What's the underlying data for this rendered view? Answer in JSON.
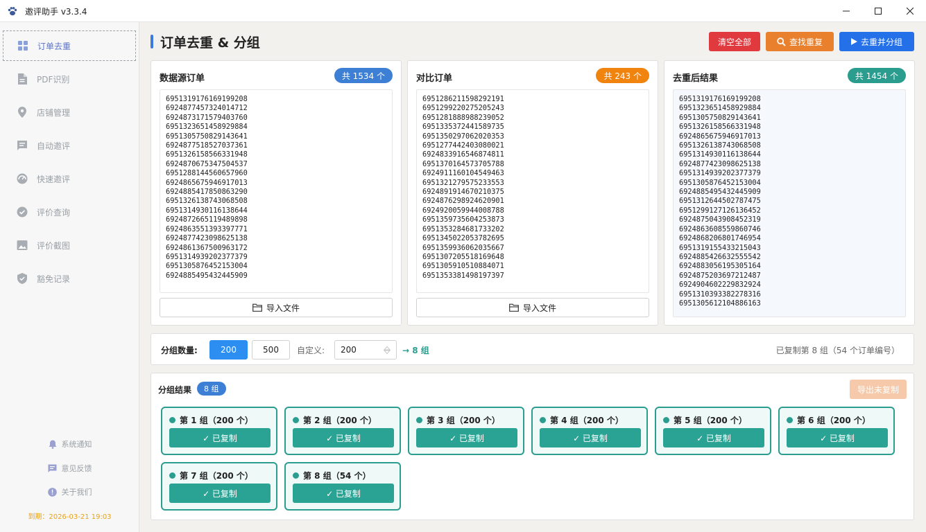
{
  "window": {
    "title": "邀评助手 v3.3.4"
  },
  "sidebar": {
    "items": [
      {
        "label": "订单去重",
        "icon": "grid-icon",
        "active": true
      },
      {
        "label": "PDF识别",
        "icon": "file-icon",
        "active": false
      },
      {
        "label": "店铺管理",
        "icon": "location-pin-icon",
        "active": false
      },
      {
        "label": "自动邀评",
        "icon": "chat-icon",
        "active": false
      },
      {
        "label": "快速邀评",
        "icon": "speed-icon",
        "active": false
      },
      {
        "label": "评价查询",
        "icon": "check-circle-icon",
        "active": false
      },
      {
        "label": "评价截图",
        "icon": "image-icon",
        "active": false
      },
      {
        "label": "豁免记录",
        "icon": "shield-check-icon",
        "active": false
      }
    ],
    "footer": {
      "notice": "系统通知",
      "feedback": "意见反馈",
      "about": "关于我们",
      "expire": "到期：2026-03-21 19:03"
    }
  },
  "header": {
    "title": "订单去重 & 分组",
    "clear_label": "清空全部",
    "find_label": "查找重复",
    "dedupe_label": "去重并分组"
  },
  "panels": {
    "source": {
      "title": "数据源订单",
      "count": "共 1534 个",
      "import_label": "导入文件",
      "lines": [
        "6951319176169199208",
        "6924877457324014712",
        "6924873171579403760",
        "6951323651458929884",
        "6951305750829143641",
        "6924877518527037361",
        "6951326158566331948",
        "6924870675347504537",
        "6951288144560657960",
        "6924865675946917013",
        "6924885417850863290",
        "6951326138743068508",
        "6951314930116138644",
        "6924872665119489898",
        "6924863551393397771",
        "6924877423098625138",
        "6924861367500963172",
        "6951314939202377379",
        "6951305876452153004",
        "6924885495432445909"
      ]
    },
    "compare": {
      "title": "对比订单",
      "count": "共 243 个",
      "import_label": "导入文件",
      "lines": [
        "6951286211598292191",
        "6951299220275205243",
        "6951281888988239052",
        "6951335372441589735",
        "6951350297062020353",
        "6951277442403080021",
        "6924833916546874811",
        "6951370164573705788",
        "6924911160104549463",
        "6951321279575233553",
        "6924891914670210375",
        "6924876298924620901",
        "6924920059944008788",
        "6951359735604253873",
        "6951353284681733202",
        "6951345022053782695",
        "6951359936062035667",
        "6951307205518169648",
        "6951305910510884071",
        "6951353381498197397"
      ]
    },
    "result": {
      "title": "去重后结果",
      "count": "共 1454 个",
      "lines": [
        "6951319176169199208",
        "6951323651458929884",
        "6951305750829143641",
        "6951326158566331948",
        "6924865675946917013",
        "6951326138743068508",
        "6951314930116138644",
        "6924877423098625138",
        "6951314939202377379",
        "6951305876452153004",
        "6924885495432445909",
        "6951312644502787475",
        "6951299127126136452",
        "6924875043908452319",
        "6924863608559860746",
        "6924868206801746954",
        "6951319155433215043",
        "6924885426632555542",
        "6924883056195305164",
        "6924875203697212487",
        "6924904602229832924",
        "6951310393382278316",
        "6951305612104886163"
      ]
    }
  },
  "grouping": {
    "label": "分组数量:",
    "option_200": "200",
    "option_500": "500",
    "custom_label": "自定义:",
    "custom_value": "200",
    "arrow_text": "→ 8 组",
    "copied_info": "已复制第 8 组（54 个订单编号）"
  },
  "results": {
    "title": "分组结果",
    "badge": "8 组",
    "export_label": "导出未复制",
    "groups": [
      {
        "name": "第 1 组（200 个）",
        "button": "✓ 已复制"
      },
      {
        "name": "第 2 组（200 个）",
        "button": "✓ 已复制"
      },
      {
        "name": "第 3 组（200 个）",
        "button": "✓ 已复制"
      },
      {
        "name": "第 4 组（200 个）",
        "button": "✓ 已复制"
      },
      {
        "name": "第 5 组（200 个）",
        "button": "✓ 已复制"
      },
      {
        "name": "第 6 组（200 个）",
        "button": "✓ 已复制"
      },
      {
        "name": "第 7 组（200 个）",
        "button": "✓ 已复制"
      },
      {
        "name": "第 8 组（54 个）",
        "button": "✓ 已复制"
      }
    ]
  },
  "colors": {
    "accent_blue": "#2370e8",
    "danger_red": "#e0393e",
    "warn_orange": "#e8802e",
    "teal": "#2a9d8f"
  }
}
